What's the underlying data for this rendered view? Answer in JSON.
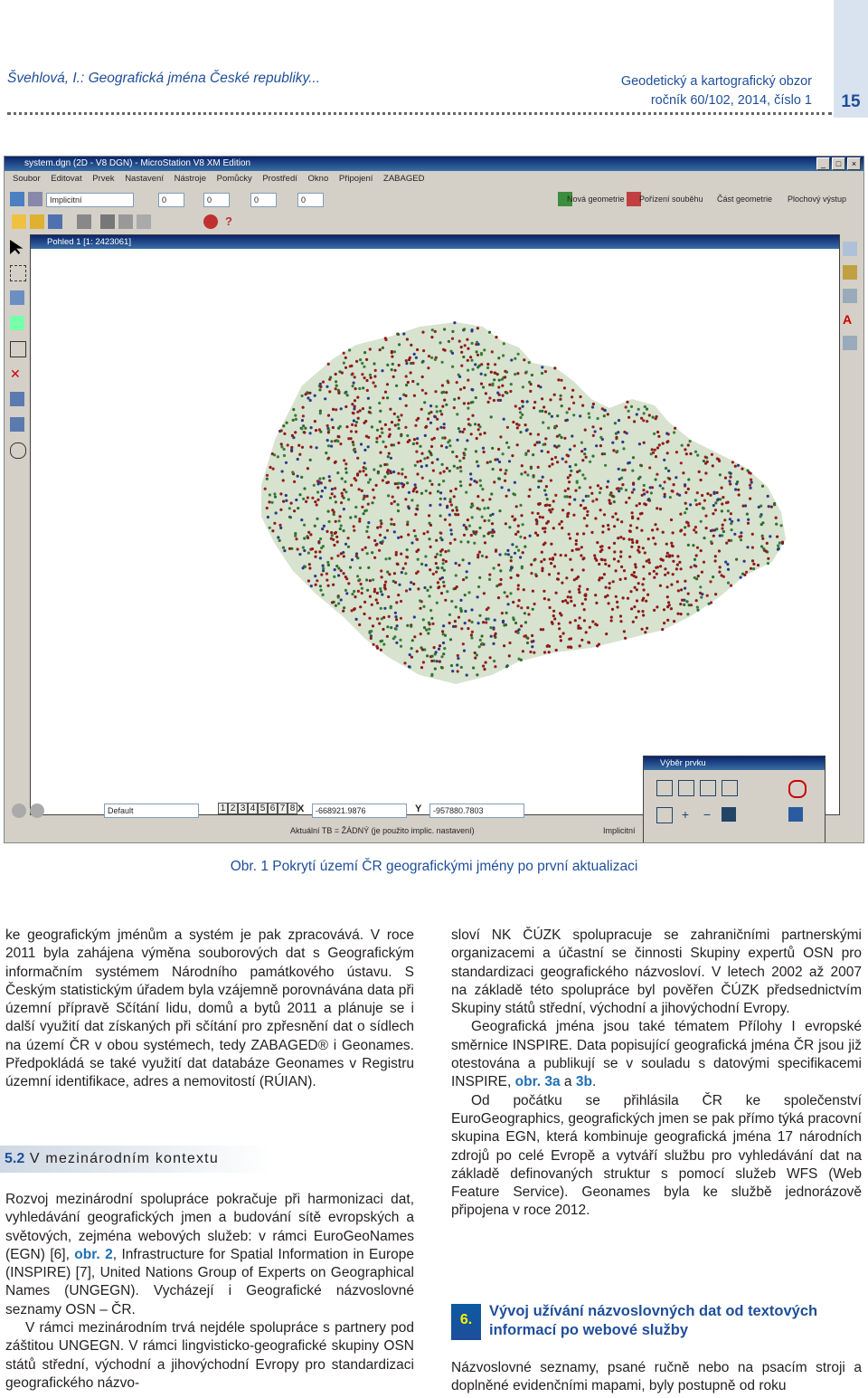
{
  "header": {
    "left": "Švehlová, I.: Geografická jména České republiky...",
    "right_line1": "Geodetický a kartografický obzor",
    "right_line2": "ročník 60/102, 2014, číslo 1",
    "page_number": "15"
  },
  "app": {
    "title": "system.dgn (2D - V8 DGN) - MicroStation V8 XM Edition",
    "menu": [
      "Soubor",
      "Editovat",
      "Prvek",
      "Nastavení",
      "Nástroje",
      "Pomůcky",
      "Prostředí",
      "Okno",
      "Připojení",
      "ZABAGED"
    ],
    "level_combo": "Implicitní",
    "zero_values": [
      "0",
      "0",
      "0",
      "0"
    ],
    "toolbar_labels": [
      "Nová geometrie",
      "Pořízení souběhu",
      "Část geometrie",
      "Plochový výstup"
    ],
    "view_title": "Pohled 1 [1: 2423061]",
    "view_combo": "Default",
    "view_numbers": [
      "1",
      "2",
      "3",
      "4",
      "5",
      "6",
      "7",
      "8"
    ],
    "x_label": "X",
    "x_value": "-668921.9876",
    "y_label": "Y",
    "y_value": "-957880.7803",
    "status_text": "Aktuální TB = ŽÁDNÝ (je použito implic. nastavení)",
    "status_right": "Implicitní",
    "popup_title": "Výběr prvku"
  },
  "caption": "Obr. 1 Pokrytí území ČR geografickými jmény po první aktualizaci",
  "left_col": {
    "p1": "ke geografickým jménům a systém je pak zpracovává. V roce 2011 byla zahájena výměna souborových dat s Geografickým informačním systémem Národního památkového ústavu. S Českým statistickým úřadem byla vzájemně porovnávána data při územní přípravě Sčítání lidu, domů a bytů 2011 a plánuje se i další využití dat získaných při sčítání pro zpřesnění dat o sídlech na území ČR v obou systémech, tedy ZABAGED® i Geonames. Předpokládá se také využití dat databáze Geonames v Registru územní identifikace, adres a nemovitostí (RÚIAN).",
    "section_num": "5.2",
    "section_title": "V mezinárodním kontextu",
    "p2a": "Rozvoj mezinárodní spolupráce pokračuje při harmonizaci dat, vyhledávání geografických jmen a budování sítě evropských a světových, zejména webových služeb: v rámci EuroGeoNames (EGN) [6], ",
    "p2_link": "obr. 2",
    "p2b": ", Infrastructure for Spatial Information in Europe (INSPIRE) [7], United Nations Group of Experts on Geographical Names (UNGEGN). Vycházejí i Geografické názvoslovné seznamy OSN – ČR.",
    "p3": "V rámci mezinárodním trvá nejdéle spolupráce s partnery pod záštitou UNGEGN. V rámci lingvisticko-geografické skupiny OSN států střední, východní a jihovýchodní Evropy pro standardizaci geografického názvo-"
  },
  "right_col": {
    "p1": "sloví NK ČÚZK spolupracuje se zahraničními partnerskými organizacemi a účastní se činnosti Skupiny expertů OSN pro standardizaci geografického názvosloví. V letech 2002 až 2007 na základě této spolupráce byl pověřen ČÚZK předsednictvím Skupiny států střední, východní a jihovýchodní Evropy.",
    "p2a": "Geografická jména jsou také tématem Přílohy I evropské směrnice INSPIRE. Data popisující geografická jména ČR jsou již otestována a publikují se v souladu s datovými specifikacemi INSPIRE, ",
    "p2_link1": "obr. 3a",
    "p2_and": " a ",
    "p2_link2": "3b",
    "p2_end": ".",
    "p3": "Od počátku se přihlásila ČR ke společenství EuroGeographics, geografických jmen se pak přímo týká pracovní skupina EGN, která kombinuje geografická jména 17 národních zdrojů po celé Evropě a vytváří službu pro vyhledávání dat na základě definovaných struktur s pomocí služeb WFS (Web Feature Service). Geonames byla ke službě jednorázově připojena v roce 2012.",
    "section_num": "6.",
    "section_title": "Vývoj užívání názvoslovných dat od textových informací po webové služby",
    "p4": "Názvoslovné seznamy, psané ručně nebo na psacím stroji a doplněné evidenčními mapami, byly postupně od roku"
  },
  "colors": {
    "blue": "#1f4e9a",
    "link": "#1f6fb5",
    "badge_text": "#fff200"
  }
}
